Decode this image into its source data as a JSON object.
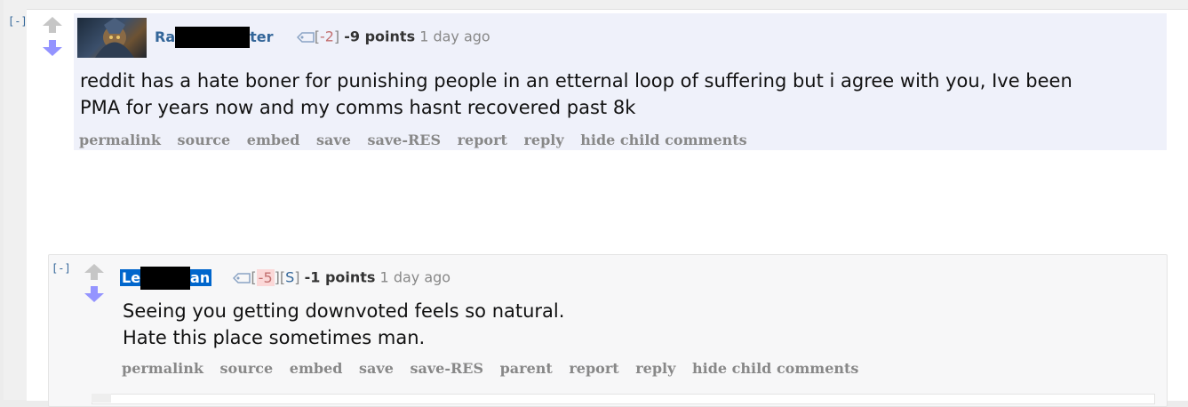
{
  "comment1": {
    "collapse_toggle": "[-]",
    "author_prefix": "Ra",
    "author_suffix": "ter",
    "flair_open": "[",
    "karma_tag": "-2",
    "flair_close": "]",
    "score": "-9 points",
    "time": "1 day ago",
    "body_line1": "reddit has a hate boner for punishing people in an etternal loop of suffering but i agree with you, Ive been",
    "body_line2": "PMA for years now and my comms hasnt recovered past 8k",
    "actions": [
      "permalink",
      "source",
      "embed",
      "save",
      "save-RES",
      "report",
      "reply",
      "hide child comments"
    ]
  },
  "comment2": {
    "collapse_toggle": "[-]",
    "author_prefix": "Le",
    "author_suffix": "an",
    "flair_open": "[",
    "karma_tag": "-5",
    "flair_mid": "][",
    "submitter_tag": "S",
    "flair_close": "]",
    "score": "-1 points",
    "time": "1 day ago",
    "body_line1": "Seeing you getting downvoted feels so natural.",
    "body_line2": "Hate this place sometimes man.",
    "actions": [
      "permalink",
      "source",
      "embed",
      "save",
      "save-RES",
      "parent",
      "report",
      "reply",
      "hide child comments"
    ]
  },
  "colors": {
    "upvote_gray": "#c6c6c6",
    "downvote_blue": "#9494ff",
    "link_blue": "#336699",
    "highlight_blue": "#0066cc"
  }
}
